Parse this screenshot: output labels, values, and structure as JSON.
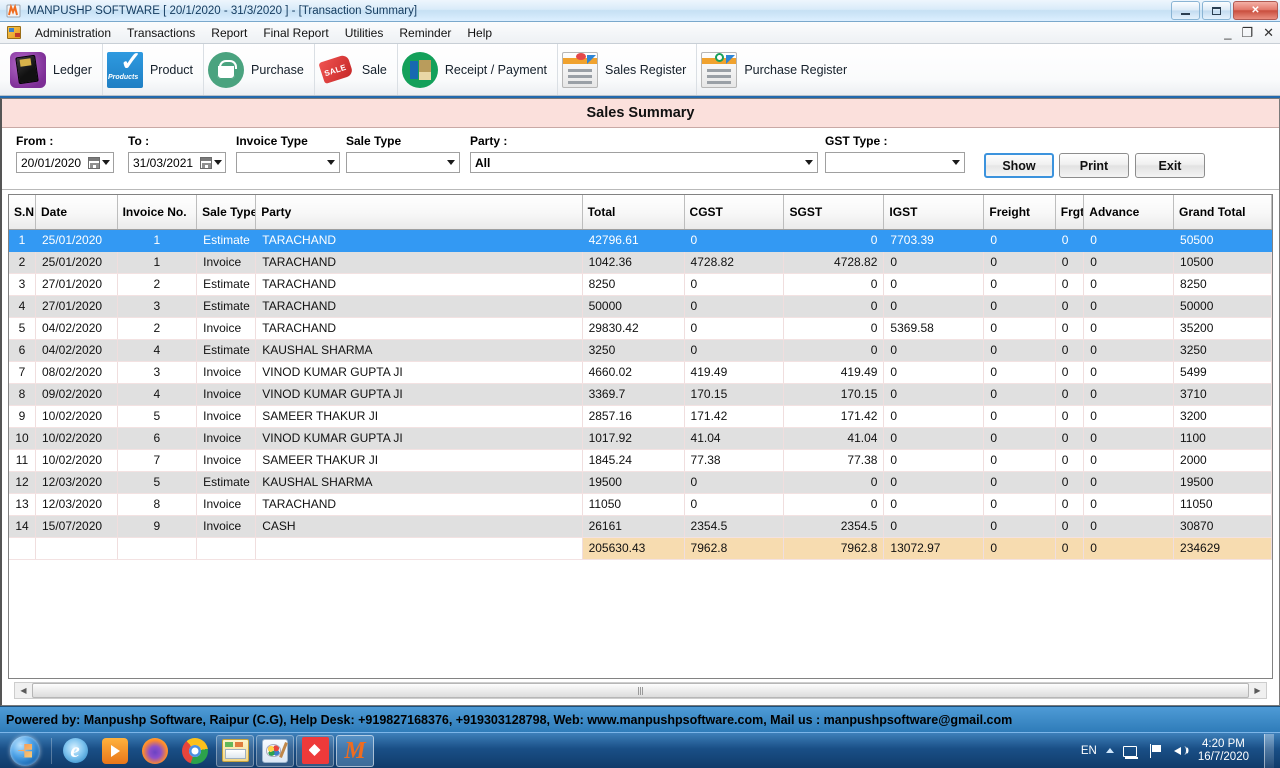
{
  "window": {
    "title": "MANPUSHP SOFTWARE [ 20/1/2020 - 31/3/2020 ]   - [Transaction Summary]",
    "minimize": "–",
    "maximize": "❐",
    "close": "✕"
  },
  "menu": {
    "items": [
      "Administration",
      "Transactions",
      "Report",
      "Final Report",
      "Utilities",
      "Reminder",
      "Help"
    ],
    "mdi_minimize": "_",
    "mdi_restore": "❐",
    "mdi_close": "✕"
  },
  "toolbar": {
    "items": [
      {
        "label": "Ledger",
        "icon": "ledger-icon"
      },
      {
        "label": "Product",
        "icon": "product-icon"
      },
      {
        "label": "Purchase",
        "icon": "purchase-icon"
      },
      {
        "label": "Sale",
        "icon": "sale-icon"
      },
      {
        "label": "Receipt / Payment",
        "icon": "receipt-payment-icon"
      },
      {
        "label": "Sales Register",
        "icon": "sales-register-icon"
      },
      {
        "label": "Purchase Register",
        "icon": "purchase-register-icon"
      }
    ]
  },
  "child_window": {
    "title": "Sales Summary"
  },
  "filters": {
    "from_label": "From :",
    "from_value": "20/01/2020",
    "to_label": "To :",
    "to_value": "31/03/2021",
    "invoice_type_label": "Invoice Type",
    "invoice_type_value": "",
    "sale_type_label": "Sale Type",
    "sale_type_value": "",
    "party_label": "Party :",
    "party_value": "All",
    "gst_type_label": "GST Type :",
    "gst_type_value": "",
    "show_label": "Show",
    "print_label": "Print",
    "exit_label": "Exit"
  },
  "grid": {
    "columns": [
      "S.N",
      "Date",
      "Invoice No.",
      "Sale Type",
      "Party",
      "Total",
      "CGST",
      "SGST",
      "IGST",
      "Freight",
      "Frgt.(",
      "Advance",
      "Grand Total"
    ],
    "rows": [
      {
        "sn": "1",
        "date": "25/01/2020",
        "inv": "1",
        "sale_type": "Estimate",
        "party": "TARACHAND",
        "total": "42796.61",
        "cgst": "0",
        "sgst": "0",
        "igst": "7703.39",
        "freight": "0",
        "frgt_gst": "0",
        "advance": "0",
        "grand_total": "50500",
        "selected": true
      },
      {
        "sn": "2",
        "date": "25/01/2020",
        "inv": "1",
        "sale_type": "Invoice",
        "party": "TARACHAND",
        "total": "1042.36",
        "cgst": "4728.82",
        "sgst": "4728.82",
        "igst": "0",
        "freight": "0",
        "frgt_gst": "0",
        "advance": "0",
        "grand_total": "10500",
        "selected": false
      },
      {
        "sn": "3",
        "date": "27/01/2020",
        "inv": "2",
        "sale_type": "Estimate",
        "party": "TARACHAND",
        "total": "8250",
        "cgst": "0",
        "sgst": "0",
        "igst": "0",
        "freight": "0",
        "frgt_gst": "0",
        "advance": "0",
        "grand_total": "8250",
        "selected": false
      },
      {
        "sn": "4",
        "date": "27/01/2020",
        "inv": "3",
        "sale_type": "Estimate",
        "party": "TARACHAND",
        "total": "50000",
        "cgst": "0",
        "sgst": "0",
        "igst": "0",
        "freight": "0",
        "frgt_gst": "0",
        "advance": "0",
        "grand_total": "50000",
        "selected": false
      },
      {
        "sn": "5",
        "date": "04/02/2020",
        "inv": "2",
        "sale_type": "Invoice",
        "party": "TARACHAND",
        "total": "29830.42",
        "cgst": "0",
        "sgst": "0",
        "igst": "5369.58",
        "freight": "0",
        "frgt_gst": "0",
        "advance": "0",
        "grand_total": "35200",
        "selected": false
      },
      {
        "sn": "6",
        "date": "04/02/2020",
        "inv": "4",
        "sale_type": "Estimate",
        "party": "KAUSHAL SHARMA",
        "total": "3250",
        "cgst": "0",
        "sgst": "0",
        "igst": "0",
        "freight": "0",
        "frgt_gst": "0",
        "advance": "0",
        "grand_total": "3250",
        "selected": false
      },
      {
        "sn": "7",
        "date": "08/02/2020",
        "inv": "3",
        "sale_type": "Invoice",
        "party": "VINOD KUMAR GUPTA JI",
        "total": "4660.02",
        "cgst": "419.49",
        "sgst": "419.49",
        "igst": "0",
        "freight": "0",
        "frgt_gst": "0",
        "advance": "0",
        "grand_total": "5499",
        "selected": false
      },
      {
        "sn": "8",
        "date": "09/02/2020",
        "inv": "4",
        "sale_type": "Invoice",
        "party": "VINOD KUMAR GUPTA JI",
        "total": "3369.7",
        "cgst": "170.15",
        "sgst": "170.15",
        "igst": "0",
        "freight": "0",
        "frgt_gst": "0",
        "advance": "0",
        "grand_total": "3710",
        "selected": false
      },
      {
        "sn": "9",
        "date": "10/02/2020",
        "inv": "5",
        "sale_type": "Invoice",
        "party": "SAMEER THAKUR JI",
        "total": "2857.16",
        "cgst": "171.42",
        "sgst": "171.42",
        "igst": "0",
        "freight": "0",
        "frgt_gst": "0",
        "advance": "0",
        "grand_total": "3200",
        "selected": false
      },
      {
        "sn": "10",
        "date": "10/02/2020",
        "inv": "6",
        "sale_type": "Invoice",
        "party": "VINOD KUMAR GUPTA JI",
        "total": "1017.92",
        "cgst": "41.04",
        "sgst": "41.04",
        "igst": "0",
        "freight": "0",
        "frgt_gst": "0",
        "advance": "0",
        "grand_total": "1100",
        "selected": false
      },
      {
        "sn": "11",
        "date": "10/02/2020",
        "inv": "7",
        "sale_type": "Invoice",
        "party": "SAMEER THAKUR JI",
        "total": "1845.24",
        "cgst": "77.38",
        "sgst": "77.38",
        "igst": "0",
        "freight": "0",
        "frgt_gst": "0",
        "advance": "0",
        "grand_total": "2000",
        "selected": false
      },
      {
        "sn": "12",
        "date": "12/03/2020",
        "inv": "5",
        "sale_type": "Estimate",
        "party": "KAUSHAL SHARMA",
        "total": "19500",
        "cgst": "0",
        "sgst": "0",
        "igst": "0",
        "freight": "0",
        "frgt_gst": "0",
        "advance": "0",
        "grand_total": "19500",
        "selected": false
      },
      {
        "sn": "13",
        "date": "12/03/2020",
        "inv": "8",
        "sale_type": "Invoice",
        "party": "TARACHAND",
        "total": "11050",
        "cgst": "0",
        "sgst": "0",
        "igst": "0",
        "freight": "0",
        "frgt_gst": "0",
        "advance": "0",
        "grand_total": "11050",
        "selected": false
      },
      {
        "sn": "14",
        "date": "15/07/2020",
        "inv": "9",
        "sale_type": "Invoice",
        "party": "CASH",
        "total": "26161",
        "cgst": "2354.5",
        "sgst": "2354.5",
        "igst": "0",
        "freight": "0",
        "frgt_gst": "0",
        "advance": "0",
        "grand_total": "30870",
        "selected": false
      }
    ],
    "totals": {
      "sn": "",
      "date": "",
      "inv": "",
      "sale_type": "",
      "party": "",
      "total": "205630.43",
      "cgst": "7962.8",
      "sgst": "7962.8",
      "igst": "13072.97",
      "freight": "0",
      "frgt_gst": "0",
      "advance": "0",
      "grand_total": "234629"
    }
  },
  "footer": {
    "text": "Powered by: Manpushp Software, Raipur (C.G), Help Desk: +919827168376, +919303128798, Web: www.manpushpsoftware.com,  Mail us :  manpushpsoftware@gmail.com"
  },
  "taskbar": {
    "start": "start-orb",
    "buttons": [
      {
        "name": "internet-explorer",
        "pinned": false,
        "active": false
      },
      {
        "name": "windows-media-player",
        "pinned": false,
        "active": false
      },
      {
        "name": "firefox",
        "pinned": false,
        "active": false
      },
      {
        "name": "google-chrome",
        "pinned": false,
        "active": false
      },
      {
        "name": "windows-explorer",
        "pinned": true,
        "active": false
      },
      {
        "name": "paint",
        "pinned": true,
        "active": false
      },
      {
        "name": "red-app",
        "pinned": true,
        "active": false
      },
      {
        "name": "manpushp-software",
        "pinned": false,
        "active": true
      }
    ],
    "language": "EN",
    "time": "4:20 PM",
    "date": "16/7/2020"
  }
}
